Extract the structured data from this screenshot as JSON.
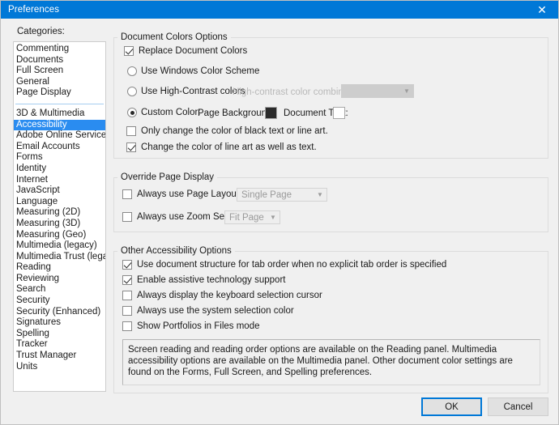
{
  "window": {
    "title": "Preferences",
    "close_icon": "close-icon",
    "accent_color": "#0078d7",
    "selection_color": "#2a8cf0",
    "background_color": "#f0f0f0"
  },
  "sidebar": {
    "label": "Categories:",
    "selected": "Accessibility",
    "group_one": [
      {
        "label": "Commenting"
      },
      {
        "label": "Documents"
      },
      {
        "label": "Full Screen"
      },
      {
        "label": "General"
      },
      {
        "label": "Page Display"
      }
    ],
    "group_two": [
      {
        "label": "3D & Multimedia"
      },
      {
        "label": "Accessibility"
      },
      {
        "label": "Adobe Online Services"
      },
      {
        "label": "Email Accounts"
      },
      {
        "label": "Forms"
      },
      {
        "label": "Identity"
      },
      {
        "label": "Internet"
      },
      {
        "label": "JavaScript"
      },
      {
        "label": "Language"
      },
      {
        "label": "Measuring (2D)"
      },
      {
        "label": "Measuring (3D)"
      },
      {
        "label": "Measuring (Geo)"
      },
      {
        "label": "Multimedia (legacy)"
      },
      {
        "label": "Multimedia Trust (legacy)"
      },
      {
        "label": "Reading"
      },
      {
        "label": "Reviewing"
      },
      {
        "label": "Search"
      },
      {
        "label": "Security"
      },
      {
        "label": "Security (Enhanced)"
      },
      {
        "label": "Signatures"
      },
      {
        "label": "Spelling"
      },
      {
        "label": "Tracker"
      },
      {
        "label": "Trust Manager"
      },
      {
        "label": "Units"
      }
    ]
  },
  "document_colors": {
    "title": "Document Colors Options",
    "replace_document_colors": {
      "label": "Replace Document Colors",
      "checked": true
    },
    "use_windows_color_scheme": {
      "label": "Use Windows Color Scheme",
      "checked": false
    },
    "use_high_contrast_colors": {
      "label": "Use High-Contrast colors",
      "checked": false
    },
    "high_contrast_combo_label": "High-contrast color combination:",
    "high_contrast_combo_value": "",
    "custom_color": {
      "label": "Custom Color:",
      "checked": true
    },
    "page_background_label": "Page Background:",
    "page_background_color": "#2b2b2b",
    "document_text_label": "Document Text:",
    "document_text_color": "#ffffff",
    "only_change_black_text": {
      "label": "Only change the color of black text or line art.",
      "checked": false
    },
    "change_line_art": {
      "label": "Change the color of line art as well as text.",
      "checked": true
    }
  },
  "override_page_display": {
    "title": "Override Page Display",
    "page_layout_style": {
      "label": "Always use Page Layout Style",
      "checked": false,
      "value": "Single Page"
    },
    "zoom_setting": {
      "label": "Always use Zoom Setting",
      "checked": false,
      "value": "Fit Page"
    }
  },
  "other_accessibility": {
    "title": "Other Accessibility Options",
    "options": [
      {
        "label": "Use document structure for tab order when no explicit tab order is specified",
        "checked": true
      },
      {
        "label": "Enable assistive technology support",
        "checked": true
      },
      {
        "label": "Always display the keyboard selection cursor",
        "checked": false
      },
      {
        "label": "Always use the system selection color",
        "checked": false
      },
      {
        "label": "Show Portfolios in Files mode",
        "checked": false
      }
    ]
  },
  "info_text": "Screen reading and reading order options are available on the Reading panel. Multimedia accessibility options are available on the Multimedia panel. Other document color settings are found on the Forms, Full Screen, and Spelling preferences.",
  "buttons": {
    "ok": "OK",
    "cancel": "Cancel"
  }
}
